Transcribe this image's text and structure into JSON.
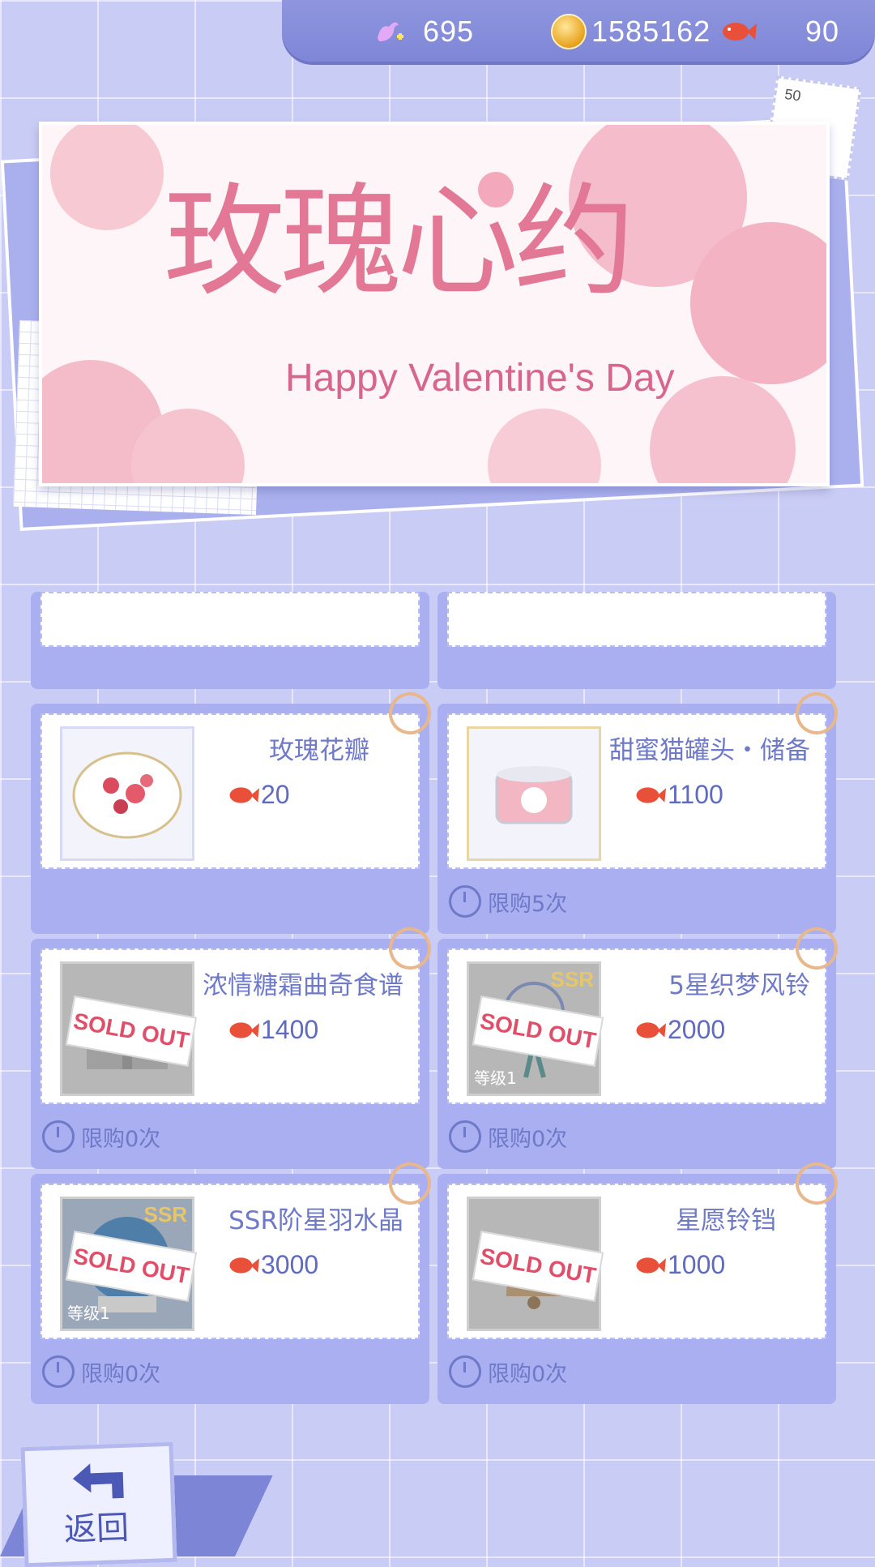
{
  "currencies": {
    "diamonds": "695",
    "gold": "1585162",
    "fish": "90"
  },
  "banner": {
    "title": "玫瑰心约",
    "subtitle": "Happy Valentine's Day",
    "stamp_number": "50"
  },
  "items": [
    {
      "name": "玫瑰花瓣",
      "price": "20",
      "limit": "",
      "sold_out": false
    },
    {
      "name": "甜蜜猫罐头・储备",
      "price": "1100",
      "limit": "限购5次",
      "sold_out": false
    },
    {
      "name": "浓情糖霜曲奇食谱",
      "price": "1400",
      "limit": "限购0次",
      "sold_out": true
    },
    {
      "name": "5星织梦风铃",
      "price": "2000",
      "limit": "限购0次",
      "sold_out": true,
      "ssr": "SSR",
      "level": "等级1"
    },
    {
      "name": "SSR阶星羽水晶",
      "price": "3000",
      "limit": "限购0次",
      "sold_out": true,
      "ssr": "SSR",
      "level": "等级1"
    },
    {
      "name": "星愿铃铛",
      "price": "1000",
      "limit": "限购0次",
      "sold_out": true
    }
  ],
  "sold_out_label": "SOLD OUT",
  "back_label": "返回",
  "colors": {
    "accent": "#6e79c7",
    "price": "#5f6ac2",
    "sold_out": "#e04f6a"
  }
}
